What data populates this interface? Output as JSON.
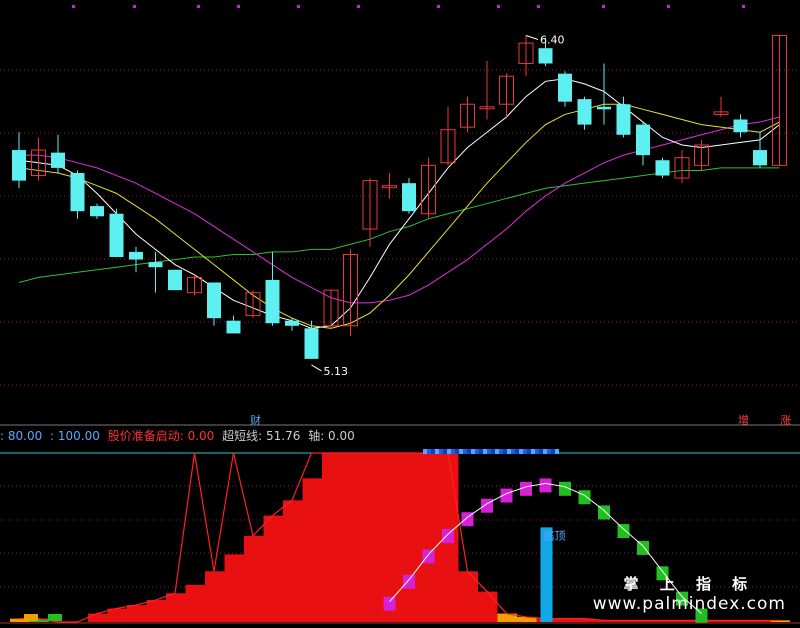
{
  "colors": {
    "background": "#000000",
    "up_candle": "#e83a3a",
    "down_candle": "#5ef0f0",
    "ma_white": "#ffffff",
    "ma_yellow": "#e8e030",
    "ma_magenta": "#e030e0",
    "ma_green": "#30c030",
    "grid": "#8a1a4a",
    "bar_red": "#e81010",
    "bar_magenta": "#d820d8",
    "bar_green": "#20c020",
    "bar_blue": "#10a8e8",
    "bar_orange": "#f0a000"
  },
  "price_panel": {
    "high_label": "6.40",
    "low_label": "5.13",
    "bottom_left_tag": "财",
    "bottom_right_tags": [
      "增",
      "涨"
    ]
  },
  "indicator_status": {
    "items": [
      {
        "text": ": 80.00",
        "color": "#5aa8ff"
      },
      {
        "text": ": 100.00",
        "color": "#5aa8ff"
      },
      {
        "text": "股价准备启动: 0.00",
        "color": "#ff3030"
      },
      {
        "text": "超短线: 51.76",
        "color": "#cccccc"
      },
      {
        "text": "轴: 0.00",
        "color": "#cccccc"
      }
    ]
  },
  "indicator_panel": {
    "peak_label": "逃顶"
  },
  "watermark": {
    "title": "掌 上 指 标",
    "url": "www.palmindex.com"
  },
  "chart_data": [
    {
      "type": "candlestick",
      "title": "",
      "ylim": [
        5.0,
        6.5
      ],
      "candles": [
        {
          "o": 5.95,
          "c": 5.83,
          "h": 6.02,
          "l": 5.8
        },
        {
          "o": 5.85,
          "c": 5.95,
          "h": 6.0,
          "l": 5.83
        },
        {
          "o": 5.94,
          "c": 5.88,
          "h": 6.01,
          "l": 5.86
        },
        {
          "o": 5.86,
          "c": 5.71,
          "h": 5.87,
          "l": 5.68
        },
        {
          "o": 5.73,
          "c": 5.69,
          "h": 5.74,
          "l": 5.68
        },
        {
          "o": 5.7,
          "c": 5.53,
          "h": 5.72,
          "l": 5.53
        },
        {
          "o": 5.55,
          "c": 5.52,
          "h": 5.57,
          "l": 5.47
        },
        {
          "o": 5.51,
          "c": 5.49,
          "h": 5.55,
          "l": 5.39
        },
        {
          "o": 5.48,
          "c": 5.4,
          "h": 5.48,
          "l": 5.4
        },
        {
          "o": 5.39,
          "c": 5.45,
          "h": 5.46,
          "l": 5.38
        },
        {
          "o": 5.43,
          "c": 5.29,
          "h": 5.43,
          "l": 5.26
        },
        {
          "o": 5.28,
          "c": 5.23,
          "h": 5.3,
          "l": 5.23
        },
        {
          "o": 5.3,
          "c": 5.39,
          "h": 5.4,
          "l": 5.29
        },
        {
          "o": 5.44,
          "c": 5.27,
          "h": 5.55,
          "l": 5.26
        },
        {
          "o": 5.28,
          "c": 5.26,
          "h": 5.29,
          "l": 5.24
        },
        {
          "o": 5.25,
          "c": 5.13,
          "h": 5.28,
          "l": 5.13
        },
        {
          "o": 5.26,
          "c": 5.4,
          "h": 5.4,
          "l": 5.25
        },
        {
          "o": 5.26,
          "c": 5.54,
          "h": 5.56,
          "l": 5.22
        },
        {
          "o": 5.64,
          "c": 5.83,
          "h": 5.84,
          "l": 5.57
        },
        {
          "o": 5.81,
          "c": 5.81,
          "h": 5.86,
          "l": 5.76
        },
        {
          "o": 5.82,
          "c": 5.71,
          "h": 5.84,
          "l": 5.7
        },
        {
          "o": 5.7,
          "c": 5.89,
          "h": 5.92,
          "l": 5.68
        },
        {
          "o": 5.9,
          "c": 6.03,
          "h": 6.12,
          "l": 5.89
        },
        {
          "o": 6.04,
          "c": 6.13,
          "h": 6.16,
          "l": 6.02
        },
        {
          "o": 6.12,
          "c": 6.12,
          "h": 6.3,
          "l": 6.07
        },
        {
          "o": 6.13,
          "c": 6.24,
          "h": 6.25,
          "l": 6.08
        },
        {
          "o": 6.29,
          "c": 6.37,
          "h": 6.4,
          "l": 6.24
        },
        {
          "o": 6.35,
          "c": 6.29,
          "h": 6.39,
          "l": 6.28
        },
        {
          "o": 6.25,
          "c": 6.14,
          "h": 6.26,
          "l": 6.12
        },
        {
          "o": 6.15,
          "c": 6.05,
          "h": 6.16,
          "l": 6.03
        },
        {
          "o": 6.12,
          "c": 6.11,
          "h": 6.29,
          "l": 6.05
        },
        {
          "o": 6.13,
          "c": 6.01,
          "h": 6.16,
          "l": 6.0
        },
        {
          "o": 6.05,
          "c": 5.93,
          "h": 6.06,
          "l": 5.89
        },
        {
          "o": 5.91,
          "c": 5.85,
          "h": 5.92,
          "l": 5.84
        },
        {
          "o": 5.84,
          "c": 5.92,
          "h": 5.95,
          "l": 5.82
        },
        {
          "o": 5.89,
          "c": 5.97,
          "h": 5.99,
          "l": 5.87
        },
        {
          "o": 6.09,
          "c": 6.1,
          "h": 6.16,
          "l": 6.08
        },
        {
          "o": 6.07,
          "c": 6.02,
          "h": 6.09,
          "l": 6.0
        },
        {
          "o": 5.95,
          "c": 5.89,
          "h": 6.02,
          "l": 5.88
        },
        {
          "o": 5.89,
          "c": 6.4,
          "h": 6.4,
          "l": 5.89
        }
      ],
      "ma_white": [
        5.91,
        5.9,
        5.89,
        5.85,
        5.78,
        5.7,
        5.62,
        5.56,
        5.5,
        5.46,
        5.41,
        5.36,
        5.33,
        5.3,
        5.28,
        5.25,
        5.26,
        5.33,
        5.45,
        5.58,
        5.68,
        5.78,
        5.88,
        5.96,
        6.02,
        6.08,
        6.16,
        6.22,
        6.23,
        6.21,
        6.18,
        6.12,
        6.06,
        6.0,
        5.97,
        5.96,
        5.97,
        5.98,
        5.99,
        6.05
      ],
      "ma_yellow": [
        5.88,
        5.87,
        5.86,
        5.84,
        5.81,
        5.78,
        5.73,
        5.68,
        5.62,
        5.56,
        5.5,
        5.44,
        5.38,
        5.33,
        5.29,
        5.26,
        5.25,
        5.27,
        5.31,
        5.38,
        5.46,
        5.55,
        5.64,
        5.73,
        5.82,
        5.9,
        5.98,
        6.05,
        6.09,
        6.11,
        6.13,
        6.13,
        6.11,
        6.09,
        6.07,
        6.05,
        6.04,
        6.03,
        6.02,
        6.06
      ],
      "ma_magenta": [
        5.93,
        5.93,
        5.92,
        5.9,
        5.88,
        5.85,
        5.82,
        5.78,
        5.74,
        5.7,
        5.65,
        5.6,
        5.55,
        5.5,
        5.45,
        5.41,
        5.37,
        5.35,
        5.35,
        5.36,
        5.38,
        5.42,
        5.47,
        5.52,
        5.58,
        5.64,
        5.71,
        5.77,
        5.82,
        5.86,
        5.9,
        5.93,
        5.95,
        5.97,
        5.99,
        6.01,
        6.03,
        6.05,
        6.06,
        6.08
      ],
      "ma_green": [
        5.43,
        5.45,
        5.46,
        5.47,
        5.48,
        5.49,
        5.5,
        5.51,
        5.52,
        5.53,
        5.53,
        5.54,
        5.54,
        5.55,
        5.55,
        5.56,
        5.56,
        5.58,
        5.6,
        5.63,
        5.65,
        5.68,
        5.7,
        5.72,
        5.74,
        5.76,
        5.78,
        5.8,
        5.81,
        5.82,
        5.83,
        5.84,
        5.85,
        5.86,
        5.87,
        5.87,
        5.88,
        5.88,
        5.88,
        5.88
      ]
    },
    {
      "type": "bar",
      "title": "",
      "ylim": [
        0,
        100
      ],
      "values": [
        2,
        2,
        0,
        0,
        5,
        8,
        10,
        13,
        17,
        22,
        30,
        40,
        51,
        63,
        72,
        85,
        100,
        100,
        100,
        100,
        100,
        100,
        100,
        30,
        18,
        5,
        3,
        2,
        2,
        2,
        1,
        1,
        1,
        1,
        1,
        1,
        1,
        1,
        1,
        1
      ],
      "value_colors": [
        "orange",
        "green",
        "none",
        "none",
        "red",
        "red",
        "red",
        "red",
        "red",
        "red",
        "red",
        "red",
        "red",
        "red",
        "red",
        "red",
        "red",
        "red",
        "red",
        "red",
        "red",
        "red",
        "red",
        "red",
        "red",
        "orange",
        "orange",
        "red",
        "red",
        "red",
        "red",
        "red",
        "red",
        "red",
        "red",
        "red",
        "red",
        "red",
        "red",
        "orange"
      ],
      "peak_line": [
        0,
        0,
        0,
        0,
        0,
        0,
        0,
        0,
        0,
        100,
        0,
        100,
        0,
        0,
        0,
        100,
        0,
        100,
        0,
        0,
        0,
        0,
        0,
        0,
        0,
        0,
        0,
        0,
        0,
        0,
        0,
        0,
        0,
        0,
        0,
        0,
        0,
        0,
        0,
        0
      ],
      "arc_values": [
        null,
        null,
        null,
        null,
        null,
        null,
        null,
        null,
        null,
        null,
        null,
        null,
        null,
        null,
        null,
        null,
        null,
        null,
        null,
        12,
        25,
        40,
        52,
        62,
        70,
        76,
        80,
        82,
        80,
        75,
        66,
        55,
        45,
        30,
        15,
        5,
        null,
        null,
        null,
        null
      ],
      "arc_colors": [
        "",
        "",
        "",
        "",
        "",
        "",
        "",
        "",
        "",
        "",
        "",
        "",
        "",
        "",
        "",
        "",
        "",
        "",
        "",
        "magenta",
        "magenta",
        "magenta",
        "magenta",
        "magenta",
        "magenta",
        "magenta",
        "magenta",
        "magenta",
        "green",
        "green",
        "green",
        "green",
        "green",
        "green",
        "green",
        "green",
        "",
        "",
        "",
        ""
      ],
      "blue_bar": {
        "index": 27,
        "value": 56
      }
    }
  ]
}
